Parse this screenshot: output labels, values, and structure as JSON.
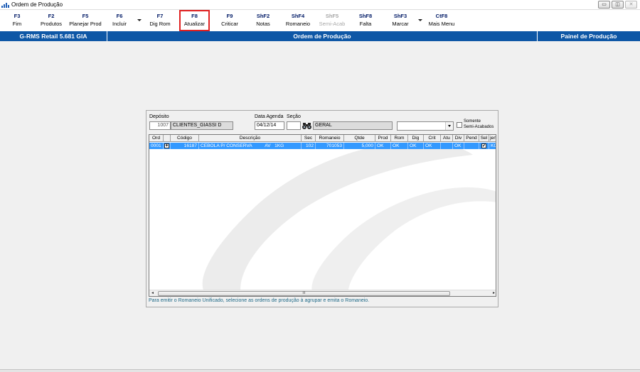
{
  "window": {
    "title": "Ordem de Produção",
    "controls": {
      "minimize": "▭",
      "restore": "◫",
      "close": "✕"
    }
  },
  "toolbar": {
    "buttons": [
      {
        "key": "F3",
        "label": "Fim"
      },
      {
        "key": "F2",
        "label": "Produtos"
      },
      {
        "key": "F5",
        "label": "Planejar Prod"
      },
      {
        "key": "F6",
        "label": "Incluir"
      },
      {
        "key": "F7",
        "label": "Dig Rom"
      },
      {
        "key": "F8",
        "label": "Atualizar"
      },
      {
        "key": "F9",
        "label": "Criticar"
      },
      {
        "key": "ShF2",
        "label": "Notas"
      },
      {
        "key": "ShF4",
        "label": "Romaneio"
      },
      {
        "key": "ShF5",
        "label": "Semi-Acab"
      },
      {
        "key": "ShF8",
        "label": "Falta"
      },
      {
        "key": "ShF3",
        "label": "Marcar"
      },
      {
        "key": "CtF8",
        "label": "Mais Menu"
      }
    ]
  },
  "header": {
    "left": "G-RMS Retail 5.681 GIA",
    "center": "Ordem de Produção",
    "right": "Painel de Produção"
  },
  "form": {
    "deposito_label": "Depósito",
    "deposito_code": "1007",
    "deposito_name": "CLIENTES_GIASSI D",
    "data_agenda_label": "Data Agenda",
    "data_agenda_value": "04/12/14",
    "secao_label": "Seção",
    "secao_code": "",
    "secao_name": "GERAL",
    "combo_value": "",
    "somente_label_1": "Somente",
    "somente_label_2": "Semi-Acabados"
  },
  "grid": {
    "columns": [
      "Ord",
      "",
      "Código",
      "Descrição",
      "Sec",
      "Romaneio",
      "Qtde",
      "Prod",
      "Rom",
      "Dig",
      "Crit",
      "Atu",
      "Div",
      "Pend",
      "Sel",
      "jen"
    ],
    "row": {
      "ord": "0001",
      "expand": "+",
      "codigo": "16187",
      "descricao": "CEBOLA P/ CONSERVA          AV   1KG",
      "sec": "102",
      "romaneio": "701053",
      "qtde": "5,000",
      "prod": "OK",
      "rom": "OK",
      "dig": "OK",
      "crit": "OK",
      "atu": "",
      "div": "OK",
      "pend": "",
      "sel": "✔",
      "jen": "KG"
    },
    "scroll_left": "◂",
    "scroll_right": "▸",
    "scroll_grip": "III"
  },
  "footer_message": "Para emitir o Romaneio Unificado, selecione as ordens de produção à agrupar e emita o Romaneio.",
  "colors": {
    "header_blue": "#0e57a6",
    "selected_row": "#3399ff",
    "highlight_red": "#e02020",
    "footer_text": "#1f6a88"
  }
}
